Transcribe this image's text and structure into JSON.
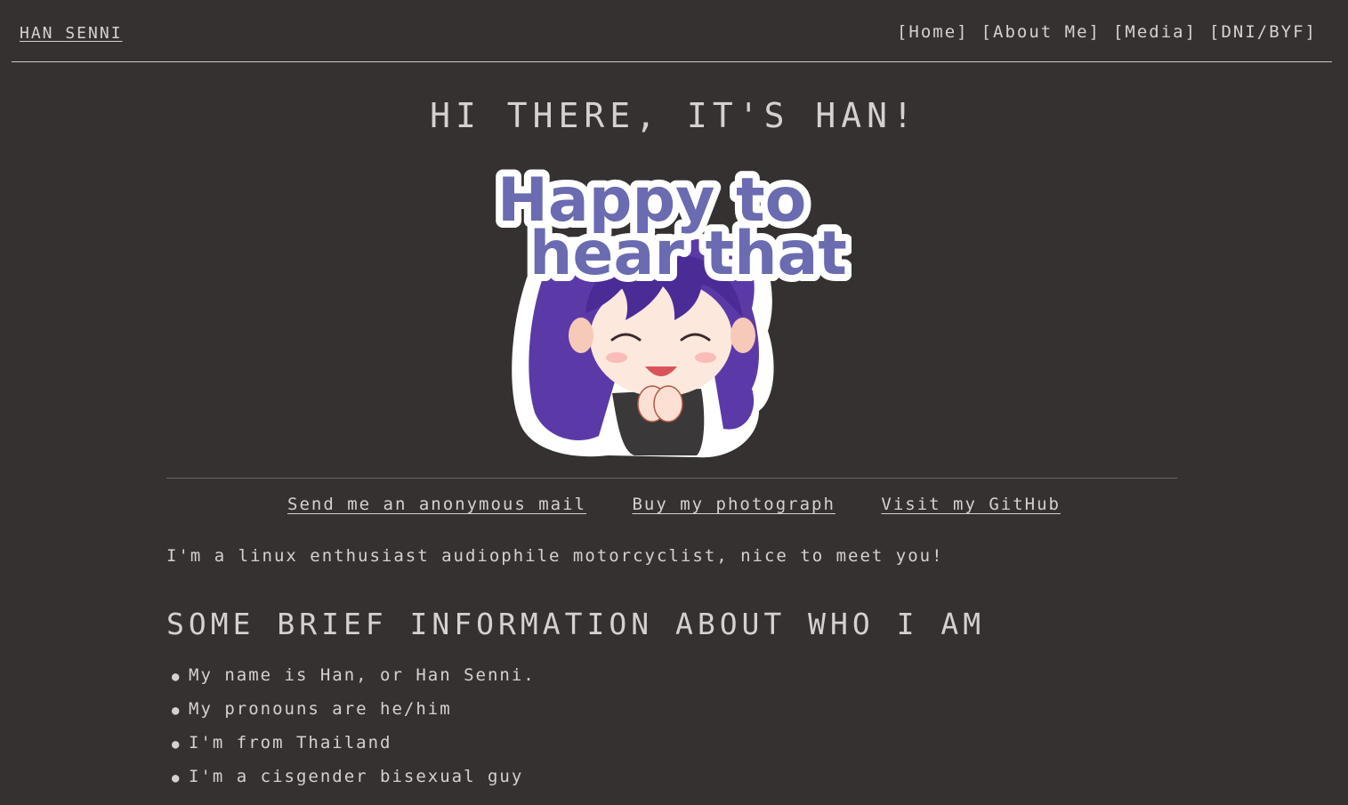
{
  "header": {
    "brand": "HAN SENNI",
    "nav": [
      "[Home]",
      "[About Me]",
      "[Media]",
      "[DNI/BYF]"
    ]
  },
  "hero": {
    "title": "HI THERE, IT'S HAN!",
    "sticker_text_line1": "Happy to",
    "sticker_text_line2": "hear that"
  },
  "links": [
    "Send me an anonymous mail",
    "Buy my photograph",
    "Visit my GitHub"
  ],
  "intro": "I'm a linux enthusiast audiophile motorcyclist, nice to meet you!",
  "about": {
    "heading": "SOME BRIEF INFORMATION ABOUT WHO I AM",
    "facts": [
      "My name is Han, or Han Senni.",
      "My pronouns are he/him",
      "I'm from Thailand",
      "I'm a cisgender bisexual guy"
    ]
  },
  "colors": {
    "background": "#353131",
    "text": "#d6d1d1",
    "sticker_text": "#6a6bb0",
    "hair": "#5b3aa8"
  }
}
